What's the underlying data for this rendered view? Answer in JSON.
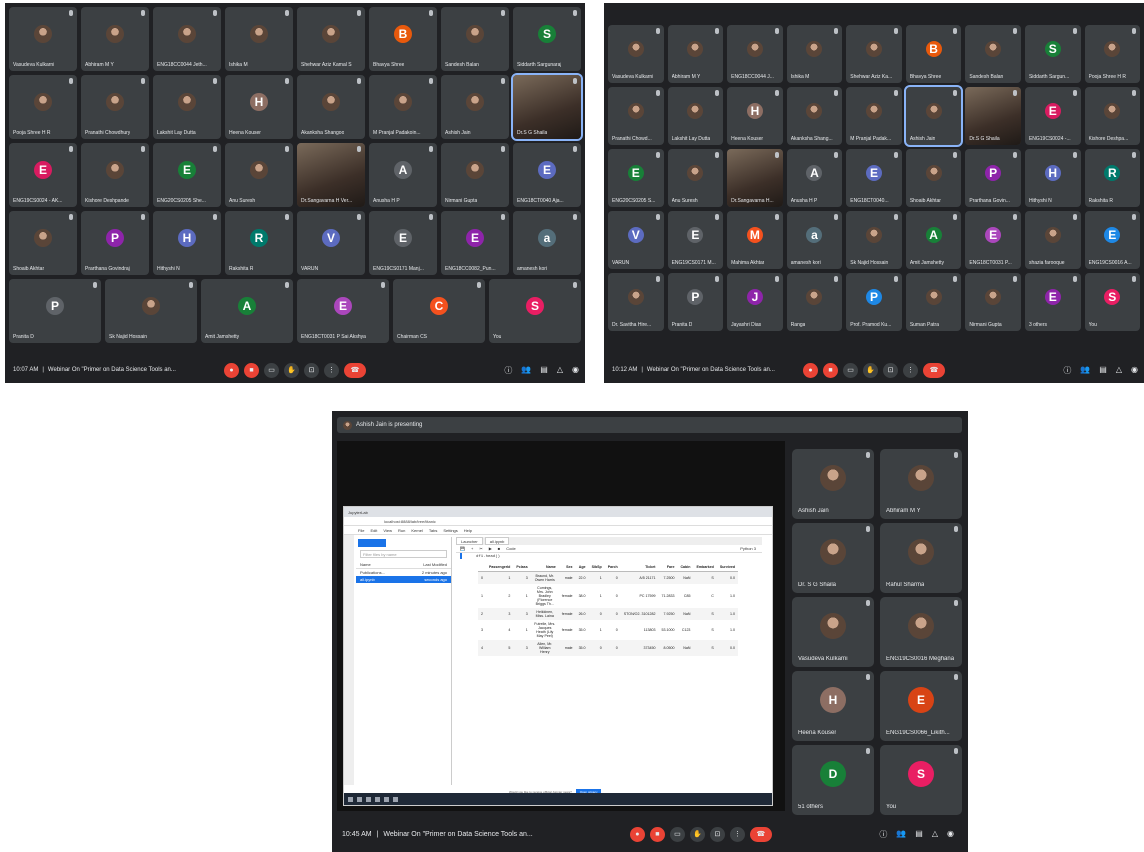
{
  "colors": {
    "bg": "#202124",
    "tile": "#3c4043",
    "accent": "#8ab4f8",
    "end": "#ea4335"
  },
  "shot1": {
    "rows": [
      [
        {
          "n": "Vasudeva Kulkarni",
          "t": "photo"
        },
        {
          "n": "Abhiram M Y",
          "t": "photo"
        },
        {
          "n": "ENG18CC0044 Jeth...",
          "t": "photo"
        },
        {
          "n": "Ishika M",
          "t": "photo"
        },
        {
          "n": "Shehwar Aziz Kamal S",
          "t": "photo"
        },
        {
          "n": "Bhavya Shree",
          "t": "letter",
          "l": "B",
          "c": "#e8590c"
        },
        {
          "n": "Sandesh Balan",
          "t": "photo"
        },
        {
          "n": "Siddarth Sargunaraj",
          "t": "letter",
          "l": "S",
          "c": "#188038"
        }
      ],
      [
        {
          "n": "Pooja Shree H R",
          "t": "photo"
        },
        {
          "n": "Pranathi Chowdhury",
          "t": "photo"
        },
        {
          "n": "Lakshit Lay Dutta",
          "t": "photo"
        },
        {
          "n": "Heena Kouser",
          "t": "letter",
          "l": "H",
          "c": "#8d6e63"
        },
        {
          "n": "Akanksha Shangoo",
          "t": "photo"
        },
        {
          "n": "M Pranjal Padakoin...",
          "t": "photo"
        },
        {
          "n": "Ashish Jain",
          "t": "photo"
        },
        {
          "n": "Dr.S G Shaila",
          "t": "video",
          "a": true
        }
      ],
      [
        {
          "n": "ENG19CS0024 - AK...",
          "t": "letter",
          "l": "E",
          "c": "#d81b60"
        },
        {
          "n": "Kishore Deshpande",
          "t": "photo"
        },
        {
          "n": "ENG20CS0205 She...",
          "t": "letter",
          "l": "E",
          "c": "#188038"
        },
        {
          "n": "Anu Suresh",
          "t": "photo"
        },
        {
          "n": "Dr.Sangavarna H Ver...",
          "t": "video"
        },
        {
          "n": "Anusha H P",
          "t": "letter",
          "l": "A",
          "c": "#5f6368"
        },
        {
          "n": "Nirmani Gupta",
          "t": "photo"
        },
        {
          "n": "ENG18CT0040 Aja...",
          "t": "letter",
          "l": "E",
          "c": "#5c6bc0"
        }
      ],
      [
        {
          "n": "Shoaib Akhtar",
          "t": "photo"
        },
        {
          "n": "Prarthana Govindraj",
          "t": "letter",
          "l": "P",
          "c": "#8e24aa"
        },
        {
          "n": "Hithyshi N",
          "t": "letter",
          "l": "H",
          "c": "#5c6bc0"
        },
        {
          "n": "Rakshita R",
          "t": "letter",
          "l": "R",
          "c": "#00796b"
        },
        {
          "n": "VARUN",
          "t": "letter",
          "l": "V",
          "c": "#5c6bc0"
        },
        {
          "n": "ENG19CS0171 Manj...",
          "t": "letter",
          "l": "E",
          "c": "#5f6368"
        },
        {
          "n": "ENG18CC0082_Pun...",
          "t": "letter",
          "l": "E",
          "c": "#8e24aa"
        },
        {
          "n": "amanesh kori",
          "t": "letter",
          "l": "a",
          "c": "#546e7a"
        }
      ],
      [
        {
          "n": "Pranita D",
          "t": "letter",
          "l": "P",
          "c": "#5f6368"
        },
        {
          "n": "Sk Najid Hossain",
          "t": "photo"
        },
        {
          "n": "Amit Jamshetty",
          "t": "letter",
          "l": "A",
          "c": "#188038"
        },
        {
          "n": "ENG18CT0031 P Sai Akshya",
          "t": "letter",
          "l": "E",
          "c": "#ab47bc"
        },
        {
          "n": "Chairman CS",
          "t": "letter",
          "l": "C",
          "c": "#f4511e"
        },
        {
          "n": "You",
          "t": "letter",
          "l": "S",
          "c": "#e91e63"
        }
      ]
    ],
    "time": "10:07 AM",
    "sep": "|",
    "meeting": "Webinar On \"Primer on Data Science Tools an..."
  },
  "shot2": {
    "rows": [
      [
        {
          "n": "Vasudeva Kulkarni",
          "t": "photo"
        },
        {
          "n": "Abhiram M Y",
          "t": "photo"
        },
        {
          "n": "ENG18CC0044 J...",
          "t": "photo"
        },
        {
          "n": "Ishika M",
          "t": "photo"
        },
        {
          "n": "Shehwar Aziz Ka...",
          "t": "photo"
        },
        {
          "n": "Bhavya Shree",
          "t": "letter",
          "l": "B",
          "c": "#e8590c"
        },
        {
          "n": "Sandesh Balan",
          "t": "photo"
        },
        {
          "n": "Siddarth Sargun...",
          "t": "letter",
          "l": "S",
          "c": "#188038"
        },
        {
          "n": "Pooja Shree H R",
          "t": "photo"
        }
      ],
      [
        {
          "n": "Pranathi Chowd...",
          "t": "photo"
        },
        {
          "n": "Lakshit Lay Dutta",
          "t": "photo"
        },
        {
          "n": "Heena Kouser",
          "t": "letter",
          "l": "H",
          "c": "#8d6e63"
        },
        {
          "n": "Akanksha Shang...",
          "t": "photo"
        },
        {
          "n": "M Pranjal Padak...",
          "t": "photo"
        },
        {
          "n": "Ashish Jain",
          "t": "photo",
          "a": true
        },
        {
          "n": "Dr.S G Shaila",
          "t": "video"
        },
        {
          "n": "ENG19CS0024 -...",
          "t": "letter",
          "l": "E",
          "c": "#d81b60"
        },
        {
          "n": "Kishore Deshpa...",
          "t": "photo"
        }
      ],
      [
        {
          "n": "ENG20CS0205 S...",
          "t": "letter",
          "l": "E",
          "c": "#188038"
        },
        {
          "n": "Anu Suresh",
          "t": "photo"
        },
        {
          "n": "Dr.Sangavarna H...",
          "t": "video"
        },
        {
          "n": "Anusha H P",
          "t": "letter",
          "l": "A",
          "c": "#5f6368"
        },
        {
          "n": "ENG18CT0040...",
          "t": "letter",
          "l": "E",
          "c": "#5c6bc0"
        },
        {
          "n": "Shoaib Akhtar",
          "t": "photo"
        },
        {
          "n": "Prarthana Govin...",
          "t": "letter",
          "l": "P",
          "c": "#8e24aa"
        },
        {
          "n": "Hithyshi N",
          "t": "letter",
          "l": "H",
          "c": "#5c6bc0"
        },
        {
          "n": "Rakshita R",
          "t": "letter",
          "l": "R",
          "c": "#00796b"
        }
      ],
      [
        {
          "n": "VARUN",
          "t": "letter",
          "l": "V",
          "c": "#5c6bc0"
        },
        {
          "n": "ENG19CS0171 M...",
          "t": "letter",
          "l": "E",
          "c": "#5f6368"
        },
        {
          "n": "Mahima Akhtar",
          "t": "letter",
          "l": "M",
          "c": "#f4511e"
        },
        {
          "n": "amanesh kori",
          "t": "letter",
          "l": "a",
          "c": "#546e7a"
        },
        {
          "n": "Sk Najid Hossain",
          "t": "photo"
        },
        {
          "n": "Amit Jamshetty",
          "t": "letter",
          "l": "A",
          "c": "#188038"
        },
        {
          "n": "ENG18CT0031 P...",
          "t": "letter",
          "l": "E",
          "c": "#ab47bc"
        },
        {
          "n": "shazia farooque",
          "t": "photo"
        },
        {
          "n": "ENG19CS0016 A...",
          "t": "letter",
          "l": "E",
          "c": "#1e88e5"
        }
      ],
      [
        {
          "n": "Dr. Savitha Hire...",
          "t": "photo"
        },
        {
          "n": "Pranita D",
          "t": "letter",
          "l": "P",
          "c": "#5f6368"
        },
        {
          "n": "Jayashri Dias",
          "t": "letter",
          "l": "J",
          "c": "#8e24aa"
        },
        {
          "n": "Ranga",
          "t": "photo"
        },
        {
          "n": "Prof. Pramod Ku...",
          "t": "letter",
          "l": "P",
          "c": "#1e88e5"
        },
        {
          "n": "Suman Patra",
          "t": "photo"
        },
        {
          "n": "Nirmani Gupta",
          "t": "photo"
        },
        {
          "n": "3 others",
          "t": "letter",
          "l": "E",
          "c": "#8e24aa"
        },
        {
          "n": "You",
          "t": "letter",
          "l": "S",
          "c": "#e91e63"
        }
      ]
    ],
    "time": "10:12 AM",
    "sep": "|",
    "meeting": "Webinar On \"Primer on Data Science Tools an..."
  },
  "shot3": {
    "presenting": "Ashish Jain is presenting",
    "browser_tab": "JupyterLab",
    "url": "localhost:8888/lab/tree/titanic",
    "menu": [
      "File",
      "Edit",
      "View",
      "Run",
      "Kernel",
      "Tabs",
      "Settings",
      "Help"
    ],
    "filter_placeholder": "Filter files by name",
    "fb_cols": [
      "Name",
      "Last Modified"
    ],
    "files": [
      {
        "name": "Publications...",
        "mod": "2 minutes ago"
      },
      {
        "name": "all.ipynb",
        "mod": "seconds ago"
      }
    ],
    "tabs": [
      "Launcher",
      "all.ipynb"
    ],
    "kernel": "Python 3",
    "celltype": "Code",
    "code": "df1.head()",
    "df_cols": [
      "",
      "PassengerId",
      "Pclass",
      "Name",
      "Sex",
      "Age",
      "SibSp",
      "Parch",
      "Ticket",
      "Fare",
      "Cabin",
      "Embarked",
      "Survived"
    ],
    "df_rows": [
      [
        "0",
        "1",
        "3",
        "Braund, Mr. Owen Harris",
        "male",
        "22.0",
        "1",
        "0",
        "A/5 21171",
        "7.2500",
        "NaN",
        "S",
        "0.0"
      ],
      [
        "1",
        "2",
        "1",
        "Cumings, Mrs. John Bradley (Florence Briggs Th...",
        "female",
        "38.0",
        "1",
        "0",
        "PC 17599",
        "71.2833",
        "C85",
        "C",
        "1.0"
      ],
      [
        "2",
        "3",
        "3",
        "Heikkinen, Miss. Laina",
        "female",
        "26.0",
        "0",
        "0",
        "STON/O2. 3101282",
        "7.9250",
        "NaN",
        "S",
        "1.0"
      ],
      [
        "3",
        "4",
        "1",
        "Futrelle, Mrs. Jacques Heath (Lily May Peel)",
        "female",
        "35.0",
        "1",
        "0",
        "113803",
        "53.1000",
        "C123",
        "S",
        "1.0"
      ],
      [
        "4",
        "5",
        "3",
        "Allen, Mr. William Henry",
        "male",
        "35.0",
        "0",
        "0",
        "373450",
        "8.0500",
        "NaN",
        "S",
        "0.0"
      ]
    ],
    "notice": "Would you like to receive official Jupyter news?",
    "notice_btn": "Open privacy",
    "side": [
      {
        "n": "Ashish Jain",
        "t": "photo",
        "a": true
      },
      {
        "n": "Abhiram M Y",
        "t": "photo"
      },
      {
        "n": "Dr. S G Shaila",
        "t": "photo"
      },
      {
        "n": "Rahul Sharma",
        "t": "photo"
      },
      {
        "n": "Vasudeva Kulkarni",
        "t": "photo"
      },
      {
        "n": "ENG19CS0016 Meghana",
        "t": "photo"
      },
      {
        "n": "Heena Kouser",
        "t": "letter",
        "l": "H",
        "c": "#8d6e63"
      },
      {
        "n": "ENG19CS0066_Likith...",
        "t": "letter",
        "l": "E",
        "c": "#d84315"
      },
      {
        "n": "51 others",
        "t": "letter",
        "l": "D",
        "c": "#188038"
      },
      {
        "n": "You",
        "t": "letter",
        "l": "S",
        "c": "#e91e63"
      }
    ],
    "time": "10:45 AM",
    "sep": "|",
    "meeting": "Webinar On \"Primer on Data Science Tools an..."
  },
  "icons": {
    "mic": "mic-off-icon",
    "cam": "camera-off-icon",
    "cc": "captions-icon",
    "hand": "raise-hand-icon",
    "present": "present-icon",
    "more": "more-icon",
    "end": "end-call-icon",
    "info": "info-icon",
    "people": "people-icon",
    "chat": "chat-icon",
    "activities": "activities-icon",
    "lock": "host-controls-icon"
  }
}
